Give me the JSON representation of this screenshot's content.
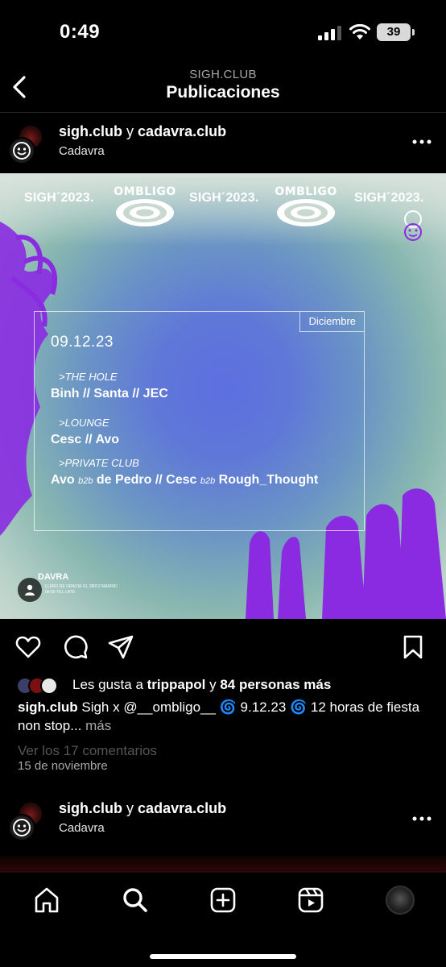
{
  "status_bar": {
    "time": "0:49",
    "battery": "39",
    "icons": [
      "cellular-signal-icon",
      "wifi-icon",
      "battery-icon"
    ]
  },
  "header": {
    "account": "SIGH.CLUB",
    "title": "Publicaciones",
    "back_icon": "chevron-left-icon"
  },
  "posts": [
    {
      "author": "sigh.club",
      "connector": "y",
      "collaborator": "cadavra.club",
      "location": "Cadavra",
      "image": {
        "header_repeats": [
          "SIGH´2023.",
          "OMBLIGO",
          "SIGH´2023.",
          "OMBLIGO",
          "SIGH´2023."
        ],
        "month": "Diciembre",
        "date": "09.12.23",
        "rooms": [
          {
            "name": ">THE HOLE",
            "lineup": "Binh // Santa // JEC"
          },
          {
            "name": ">LOUNGE",
            "lineup": "Cesc // Avo"
          },
          {
            "name": ">PRIVATE CLUB",
            "lineup_parts": [
              "Avo",
              "b2b",
              "de Pedro // Cesc",
              "b2b",
              "Rough_Thought"
            ]
          }
        ],
        "venue": "DAVRA",
        "venue_address": "LLERO DE GRACIA 10, 28013 MADRID",
        "venue_hours": "00:00 TILL LATE"
      },
      "likes": {
        "prefix": "Les gusta a",
        "user": "trippapol",
        "connector": "y",
        "others": "84 personas más"
      },
      "caption": {
        "author": "sigh.club",
        "text": "Sigh x @__ombligo__ 🌀 9.12.23 🌀 12 horas de fiesta non stop...",
        "more": "más"
      },
      "comments_link": "Ver los 17 comentarios",
      "date": "15 de noviembre"
    },
    {
      "author": "sigh.club",
      "connector": "y",
      "collaborator": "cadavra.club",
      "location": "Cadavra"
    }
  ],
  "actions": [
    "heart-icon",
    "comment-icon",
    "share-icon",
    "bookmark-icon"
  ],
  "tab_bar": [
    "home-icon",
    "search-icon",
    "create-post-icon",
    "reels-icon",
    "profile-avatar"
  ],
  "colors": {
    "background": "#000000",
    "text": "#ffffff",
    "secondary_text": "#a8a8a8",
    "poster_purple": "#8a2be2",
    "poster_blue": "#5d6fe0"
  }
}
